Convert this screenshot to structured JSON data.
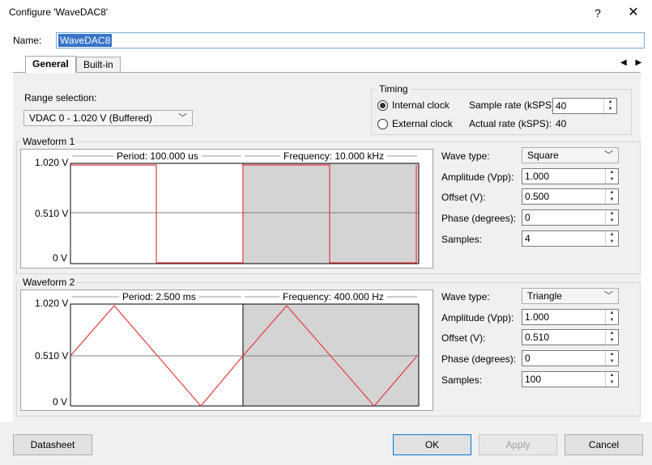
{
  "window": {
    "title": "Configure 'WaveDAC8'",
    "help": "?",
    "close": "✕"
  },
  "name_field": {
    "label": "Name:",
    "value": "WaveDAC8"
  },
  "tabs": [
    {
      "label": "General",
      "active": true
    },
    {
      "label": "Built-in",
      "active": false
    }
  ],
  "tab_scroll": "◀ ▶",
  "range": {
    "label": "Range selection:",
    "value": "VDAC 0 - 1.020 V (Buffered)"
  },
  "timing": {
    "title": "Timing",
    "internal_clock": "Internal clock",
    "external_clock": "External clock",
    "internal_selected": true,
    "sample_rate_label": "Sample rate (kSPS):",
    "sample_rate_value": "40",
    "actual_rate_label": "Actual rate (kSPS):",
    "actual_rate_value": "40"
  },
  "waveform1": {
    "title": "Waveform 1",
    "period": "Period: 100.000 us",
    "frequency": "Frequency: 10.000 kHz",
    "y_ticks": [
      "1.020 V",
      "0.510 V",
      "0 V"
    ],
    "wave_type_label": "Wave type:",
    "wave_type": "Square",
    "amplitude_label": "Amplitude (Vpp):",
    "amplitude": "1.000",
    "offset_label": "Offset (V):",
    "offset": "0.500",
    "phase_label": "Phase (degrees):",
    "phase": "0",
    "samples_label": "Samples:",
    "samples": "4"
  },
  "waveform2": {
    "title": "Waveform 2",
    "period": "Period: 2.500 ms",
    "frequency": "Frequency: 400.000 Hz",
    "y_ticks": [
      "1.020 V",
      "0.510 V",
      "0 V"
    ],
    "wave_type_label": "Wave type:",
    "wave_type": "Triangle",
    "amplitude_label": "Amplitude (Vpp):",
    "amplitude": "1.000",
    "offset_label": "Offset (V):",
    "offset": "0.510",
    "phase_label": "Phase (degrees):",
    "phase": "0",
    "samples_label": "Samples:",
    "samples": "100"
  },
  "buttons": {
    "datasheet": "Datasheet",
    "ok": "OK",
    "apply": "Apply",
    "cancel": "Cancel"
  },
  "colors": {
    "wave": "#e8383d",
    "shaded": "#d4d4d4",
    "accent": "#0078d7"
  }
}
